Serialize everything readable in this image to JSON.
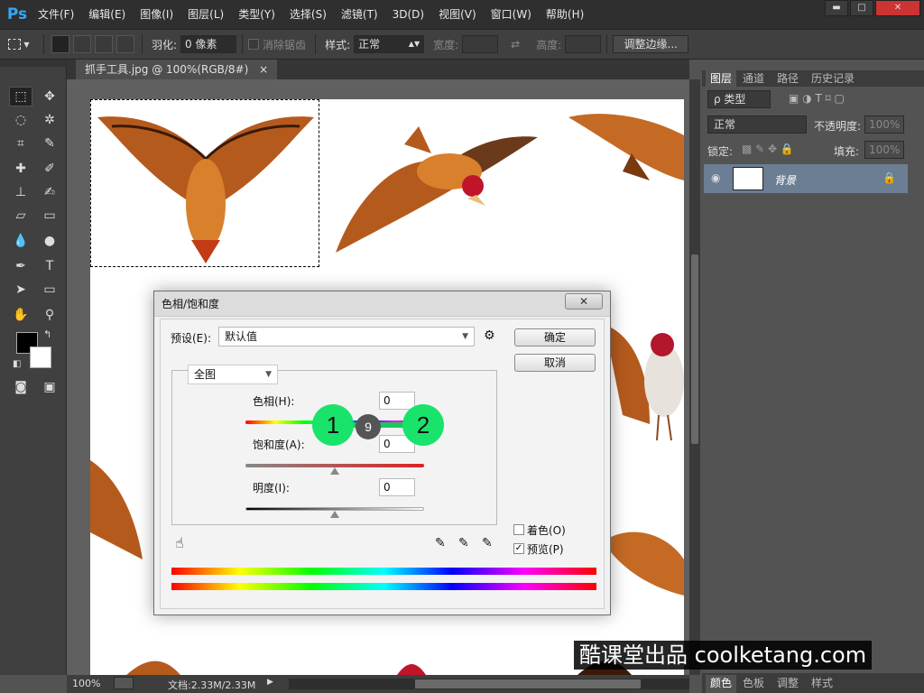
{
  "app": {
    "logo": "Ps"
  },
  "menu": [
    "文件(F)",
    "编辑(E)",
    "图像(I)",
    "图层(L)",
    "类型(Y)",
    "选择(S)",
    "滤镜(T)",
    "3D(D)",
    "视图(V)",
    "窗口(W)",
    "帮助(H)"
  ],
  "window_buttons": {
    "minimize": "▬",
    "maximize": "□",
    "close": "✕"
  },
  "options": {
    "feather_label": "羽化:",
    "feather_value": "0 像素",
    "antialias_label": "消除锯齿",
    "style_label": "样式:",
    "style_value": "正常",
    "width_label": "宽度:",
    "height_label": "高度:",
    "refine_edge": "调整边缘..."
  },
  "document": {
    "tab_title": "抓手工具.jpg @ 100%(RGB/8#)",
    "close_icon": "×",
    "zoom": "100%",
    "doc_size": "文档:2.33M/2.33M"
  },
  "panels": {
    "tabs": [
      "图层",
      "通道",
      "路径",
      "历史记录"
    ],
    "kind_label": "ρ 类型",
    "blend_mode": "正常",
    "opacity_label": "不透明度:",
    "opacity_value": "100%",
    "lock_label": "锁定:",
    "fill_label": "填充:",
    "fill_value": "100%",
    "layer_name": "背景",
    "bottom_tabs": [
      "颜色",
      "色板",
      "调整",
      "样式"
    ]
  },
  "dialog": {
    "title": "色相/饱和度",
    "close": "✕",
    "preset_label": "预设(E):",
    "preset_value": "默认值",
    "ok": "确定",
    "cancel": "取消",
    "channel": "全图",
    "hue_label": "色相(H):",
    "hue_value": "0",
    "saturation_label": "饱和度(A):",
    "saturation_value": "0",
    "lightness_label": "明度(I):",
    "lightness_value": "0",
    "colorize_label": "着色(O)",
    "preview_label": "预览(P)",
    "colorize_checked": false,
    "preview_checked": true
  },
  "annotations": {
    "step1": "1",
    "step_mid": "9",
    "step2": "2"
  },
  "watermark": "酷课堂出品 coolketang.com",
  "colors": {
    "accent_green": "#19e36b",
    "ps_blue": "#31a8ff",
    "layer_selected": "#6c7e93"
  }
}
